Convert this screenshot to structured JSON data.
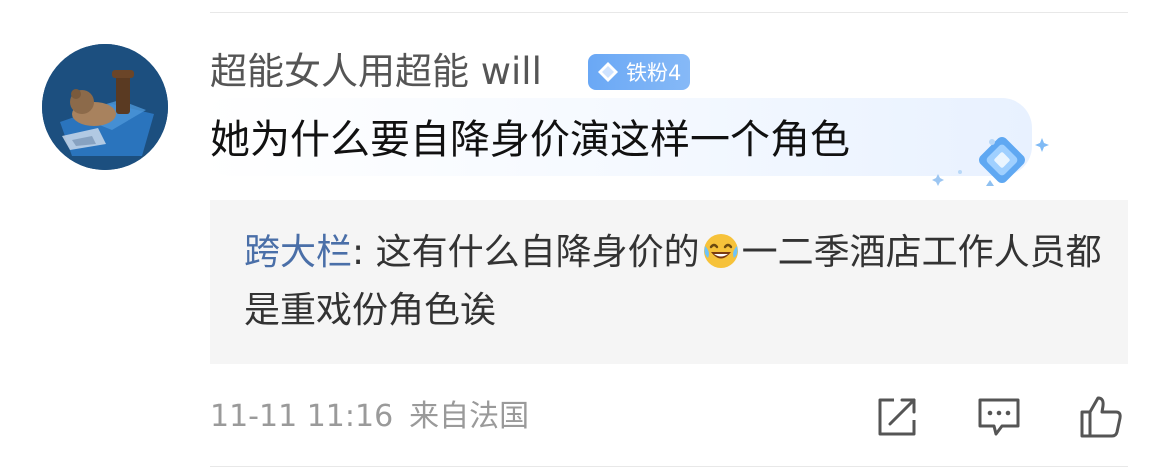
{
  "comment": {
    "username": "超能女人用超能 will",
    "badge": {
      "label": "铁粉4",
      "icon": "diamond-icon",
      "color": "#6aa8f5"
    },
    "text": "她为什么要自降身价演这样一个角色"
  },
  "reply": {
    "username": "跨大栏",
    "separator": ": ",
    "text_before_emoji": "这有什么自降身价的",
    "emoji": "laughing-tears-emoji",
    "text_after_emoji": "一二季酒店工作人员都是重戏份角色诶"
  },
  "meta": {
    "timestamp": "11-11 11:16",
    "location": "来自法国"
  },
  "actions": [
    {
      "icon": "share-icon"
    },
    {
      "icon": "comment-icon"
    },
    {
      "icon": "like-icon"
    }
  ],
  "colors": {
    "reply_username": "#4a6fa8",
    "meta_text": "#9a9a9a",
    "reply_background": "#f5f5f5"
  }
}
